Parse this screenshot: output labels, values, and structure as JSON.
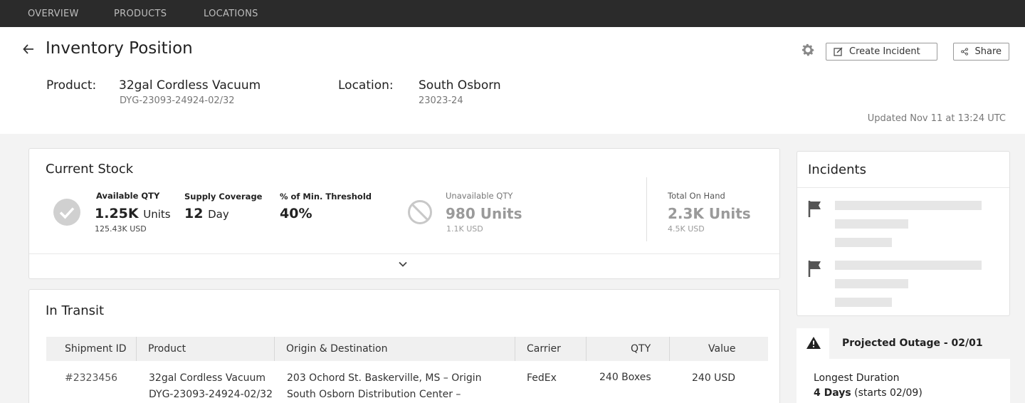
{
  "nav": {
    "items": [
      "OVERVIEW",
      "PRODUCTS",
      "LOCATIONS"
    ]
  },
  "header": {
    "title": "Inventory Position",
    "create_incident_label": "Create Incident",
    "share_label": "Share",
    "product_label": "Product:",
    "product_name": "32gal Cordless Vacuum",
    "product_sku": "DYG-23093-24924-02/32",
    "location_label": "Location:",
    "location_name": "South Osborn",
    "location_code": "23023-24",
    "updated": "Updated Nov 11 at 13:24 UTC"
  },
  "current_stock": {
    "title": "Current Stock",
    "available_label": "Available QTY",
    "available_value": "1.25K",
    "available_unit": "Units",
    "available_usd": "125.43K USD",
    "coverage_label": "Supply Coverage",
    "coverage_value": "12",
    "coverage_unit": "Days",
    "threshold_label": "% of Min. Threshold",
    "threshold_value": "40%",
    "unavailable_label": "Unavailable QTY",
    "unavailable_value": "980 Units",
    "unavailable_usd": "1.1K USD",
    "total_label": "Total On Hand",
    "total_value": "2.3K Units",
    "total_usd": "4.5K USD"
  },
  "in_transit": {
    "title": "In Transit",
    "columns": [
      "Shipment ID",
      "Product",
      "Origin & Destination",
      "Carrier",
      "QTY",
      "Value"
    ],
    "rows": [
      {
        "id": "#2323456",
        "product": "32gal Cordless Vacuum",
        "sku": "DYG-23093-24924-02/32",
        "origin": "203 Ochord St. Baskerville, MS – Origin",
        "destination": "South Osborn Distribution Center –",
        "carrier": "FedEx",
        "qty": "240 Boxes",
        "value": "240 USD"
      }
    ]
  },
  "incidents": {
    "title": "Incidents"
  },
  "outage": {
    "title": "Projected Outage - 02/01",
    "duration_label": "Longest Duration",
    "duration_value": "4 Days",
    "duration_note": "(starts 02/09)"
  },
  "colors": {
    "topnav_bg": "#2b2b2b",
    "check_grey": "#d0d0d0",
    "skeleton": "#e6e6e6"
  }
}
